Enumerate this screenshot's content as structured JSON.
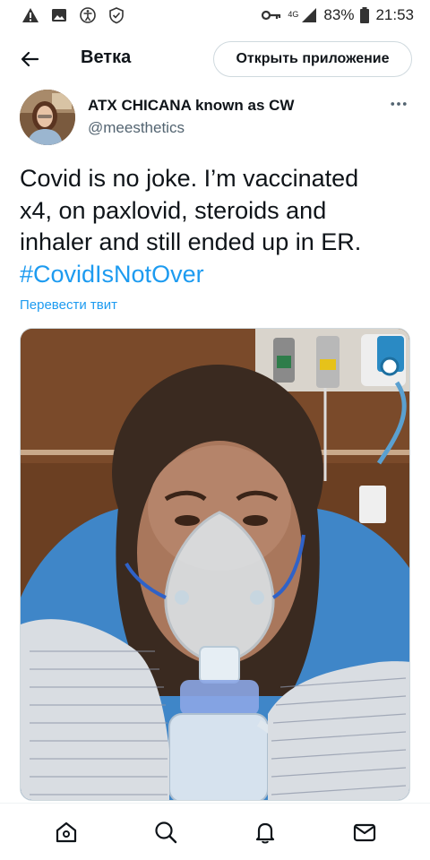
{
  "status_bar": {
    "network_label": "4G",
    "battery": "83%",
    "time": "21:53",
    "icons": [
      "warning-icon",
      "image-icon",
      "accessibility-icon",
      "shield-icon",
      "key-icon",
      "signal-icon",
      "battery-icon"
    ]
  },
  "header": {
    "title": "Ветка",
    "open_app_label": "Открыть приложение"
  },
  "tweet": {
    "author_name": "ATX CHICANA known as CW",
    "author_handle": "@meesthetics",
    "text_line1": "Covid is no joke. I’m vaccinated",
    "text_line2": "x4, on paxlovid, steroids and",
    "text_line3": "inhaler and still ended up in ER.",
    "hashtag": "#CovidIsNotOver",
    "translate_label": "Перевести твит"
  },
  "bottom_nav": {
    "items": [
      "home-icon",
      "search-icon",
      "notifications-icon",
      "messages-icon"
    ]
  },
  "colors": {
    "accent": "#1d9bf0",
    "secondary_text": "#536471",
    "primary_text": "#0f1419",
    "border": "#cfd9de"
  }
}
